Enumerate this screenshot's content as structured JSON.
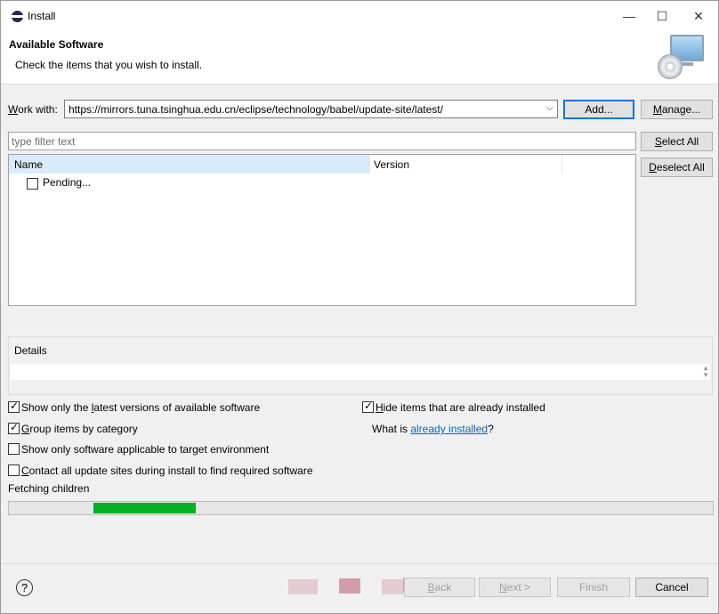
{
  "window": {
    "title": "Install",
    "minimize": "—",
    "maximize": "☐",
    "close": "✕"
  },
  "header": {
    "title": "Available Software",
    "message": "Check the items that you wish to install."
  },
  "work_with": {
    "label_prefix": "W",
    "label_rest": "ork with:",
    "value": "https://mirrors.tuna.tsinghua.edu.cn/eclipse/technology/babel/update-site/latest/",
    "add_label": "Add...",
    "manage_prefix": "M",
    "manage_rest": "anage..."
  },
  "filter": {
    "placeholder": "type filter text"
  },
  "select_all": {
    "prefix": "S",
    "rest": "elect All"
  },
  "deselect_all": {
    "prefix": "D",
    "rest": "eselect All"
  },
  "tree": {
    "columns": [
      "Name",
      "Version"
    ],
    "rows": [
      {
        "label": "Pending...",
        "checked": false
      }
    ]
  },
  "details": {
    "title": "Details"
  },
  "options": {
    "latest": {
      "pre": "Show only the ",
      "key": "l",
      "post": "atest versions of available software",
      "checked": true
    },
    "group": {
      "pre": "",
      "key": "G",
      "post": "roup items by category",
      "checked": true
    },
    "target": {
      "pre": "Show only software applicable to target environment",
      "key": "",
      "post": "",
      "checked": false
    },
    "contact": {
      "pre": "",
      "key": "C",
      "post": "ontact all update sites during install to find required software",
      "checked": false
    },
    "hide": {
      "pre": "",
      "key": "H",
      "post": "ide items that are already installed",
      "checked": true
    },
    "what_is_pre": "What is ",
    "what_is_link": "already installed",
    "what_is_post": "?"
  },
  "status": {
    "text": "Fetching children",
    "progress_fraction": 0.145
  },
  "footer": {
    "help": "?",
    "back_prefix": "B",
    "back_rest": "ack",
    "next_prefix": "N",
    "next_rest": "ext >",
    "finish": "Finish",
    "cancel": "Cancel"
  },
  "colors": {
    "progress": "#06b025",
    "link": "#0066cc",
    "default_button_border": "#0078d7"
  }
}
